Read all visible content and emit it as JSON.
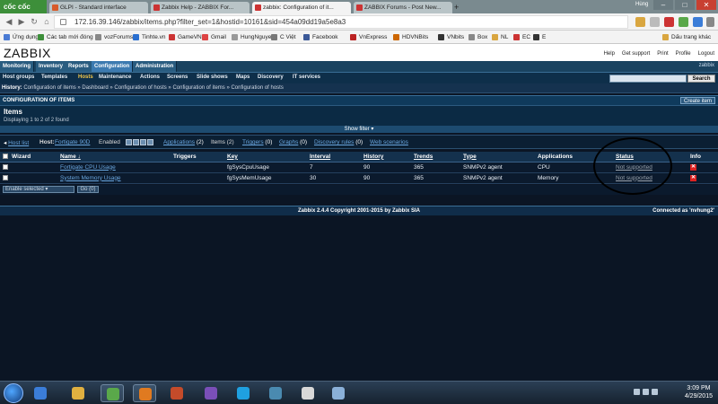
{
  "browser": {
    "brand": "cốc cốc",
    "tabs": [
      {
        "label": "GLPI - Standard interface",
        "active": false
      },
      {
        "label": "Zabbix Help - ZABBIX For...",
        "active": false
      },
      {
        "label": "zabbix: Configuration of it...",
        "active": true
      },
      {
        "label": "ZABBIX Forums - Post New...",
        "active": false
      }
    ],
    "profile_label": "Hùng",
    "url": "172.16.39.146/zabbix/items.php?filter_set=1&hostid=10161&sid=454a09dd19a5e8a3",
    "bookmarks": [
      {
        "label": "Ứng dụng",
        "color": "#4a7bd4"
      },
      {
        "label": "Các tab mới đóng",
        "color": "#3d8f3a"
      },
      {
        "label": "vozForums",
        "color": "#888"
      },
      {
        "label": "Tinhte.vn",
        "color": "#2a6fd0"
      },
      {
        "label": "GameVN",
        "color": "#c33"
      },
      {
        "label": "Gmail",
        "color": "#d44"
      },
      {
        "label": "HungNguyen",
        "color": "#999"
      },
      {
        "label": "C Việt",
        "color": "#777"
      },
      {
        "label": "Facebook",
        "color": "#3b5998"
      },
      {
        "label": "VnExpress",
        "color": "#b22"
      },
      {
        "label": "HDVNBits",
        "color": "#c60"
      },
      {
        "label": "VNbits",
        "color": "#333"
      },
      {
        "label": "Box",
        "color": "#888"
      },
      {
        "label": "NL",
        "color": "#d9a640"
      },
      {
        "label": "EC",
        "color": "#c33"
      },
      {
        "label": "E",
        "color": "#333"
      },
      {
        "label": "Dấu trang khác",
        "color": "#d9a640"
      }
    ]
  },
  "zabbix": {
    "logo": "ZABBIX",
    "header_links": [
      "Help",
      "Get support",
      "Print",
      "Profile",
      "Logout"
    ],
    "user": "zabbix",
    "menu": [
      {
        "label": "Monitoring",
        "active": false
      },
      {
        "label": "Inventory",
        "active": false
      },
      {
        "label": "Reports",
        "active": false
      },
      {
        "label": "Configuration",
        "active": true
      },
      {
        "label": "Administration",
        "active": false
      }
    ],
    "submenu": [
      {
        "label": "Host groups",
        "active": false
      },
      {
        "label": "Templates",
        "active": false
      },
      {
        "label": "Hosts",
        "active": true
      },
      {
        "label": "Maintenance",
        "active": false
      },
      {
        "label": "Actions",
        "active": false
      },
      {
        "label": "Screens",
        "active": false
      },
      {
        "label": "Slide shows",
        "active": false
      },
      {
        "label": "Maps",
        "active": false
      },
      {
        "label": "Discovery",
        "active": false
      },
      {
        "label": "IT services",
        "active": false
      }
    ],
    "search_button": "Search",
    "history_label": "History:",
    "history_text": "Configuration of items » Dashboard » Configuration of hosts » Configuration of items » Configuration of hosts",
    "config_title": "CONFIGURATION OF ITEMS",
    "create_button": "Create item",
    "items_title": "Items",
    "items_count": "Displaying 1 to 2 of 2 found",
    "show_filter": "Show filter",
    "hostline": {
      "host_list": "Host list",
      "host_label": "Host:",
      "host_name": "Fortigate 90D",
      "status": "Enabled",
      "applications": "Applications",
      "applications_count": "(2)",
      "items": "Items",
      "items_count": "(2)",
      "triggers": "Triggers",
      "triggers_count": "(0)",
      "graphs": "Graphs",
      "graphs_count": "(0)",
      "discovery": "Discovery rules",
      "discovery_count": "(0)",
      "web": "Web scenarios"
    },
    "table": {
      "headers": [
        "",
        "Wizard",
        "Name ↓",
        "Triggers",
        "Key",
        "Interval",
        "History",
        "Trends",
        "Type",
        "Applications",
        "Status",
        "Info"
      ],
      "rows": [
        {
          "name": "Fortigate CPU Usage",
          "key": "fgSysCpuUsage",
          "interval": "7",
          "history": "90",
          "trends": "365",
          "type": "SNMPv2 agent",
          "applications": "CPU",
          "status": "Not supported"
        },
        {
          "name": "System Memory Usage",
          "key": "fgSysMemUsage",
          "interval": "30",
          "history": "90",
          "trends": "365",
          "type": "SNMPv2 agent",
          "applications": "Memory",
          "status": "Not supported"
        }
      ]
    },
    "action_select": "Enable selected",
    "go_button": "Go (0)",
    "footer_copyright": "Zabbix 2.4.4 Copyright 2001-2015 by Zabbix SIA",
    "footer_connected": "Connected as 'nvhung2'"
  },
  "taskbar": {
    "time": "3:09 PM",
    "date": "4/29/2015",
    "apps": [
      {
        "icon": "windows-explorer-icon",
        "color": "#3b7dd8"
      },
      {
        "icon": "file-manager-icon",
        "color": "#e0b040"
      },
      {
        "icon": "coccoc-browser-icon",
        "color": "#5aa84a"
      },
      {
        "icon": "office-icon",
        "color": "#e07a20"
      },
      {
        "icon": "powerpoint-icon",
        "color": "#c44b2a"
      },
      {
        "icon": "viber-icon",
        "color": "#7a4fb8"
      },
      {
        "icon": "skype-icon",
        "color": "#1fa0e0"
      },
      {
        "icon": "network-icon",
        "color": "#4a8ab0"
      },
      {
        "icon": "notepad-icon",
        "color": "#d8d8d8"
      },
      {
        "icon": "paint-icon",
        "color": "#8ab0d8"
      }
    ]
  }
}
